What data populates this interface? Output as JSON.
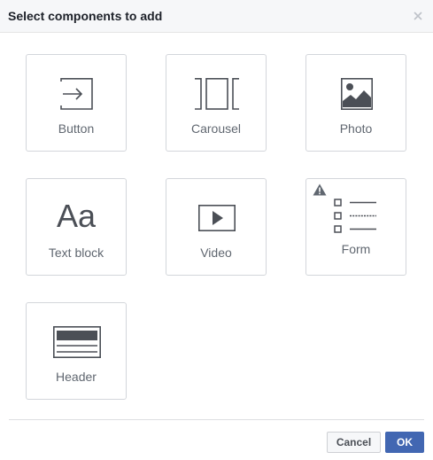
{
  "dialog": {
    "title": "Select components to add",
    "close_icon": "close-icon"
  },
  "components": [
    {
      "label": "Button",
      "icon": "button-icon"
    },
    {
      "label": "Carousel",
      "icon": "carousel-icon"
    },
    {
      "label": "Photo",
      "icon": "photo-icon"
    },
    {
      "label": "Text block",
      "icon": "text-block-icon",
      "icon_text": "Aa"
    },
    {
      "label": "Video",
      "icon": "video-icon"
    },
    {
      "label": "Form",
      "icon": "form-icon",
      "badge": "warning-icon"
    },
    {
      "label": "Header",
      "icon": "header-icon"
    }
  ],
  "footer": {
    "cancel_label": "Cancel",
    "ok_label": "OK"
  },
  "colors": {
    "icon": "#4b4f56",
    "primary": "#4267b2",
    "border": "#d3d6db"
  }
}
